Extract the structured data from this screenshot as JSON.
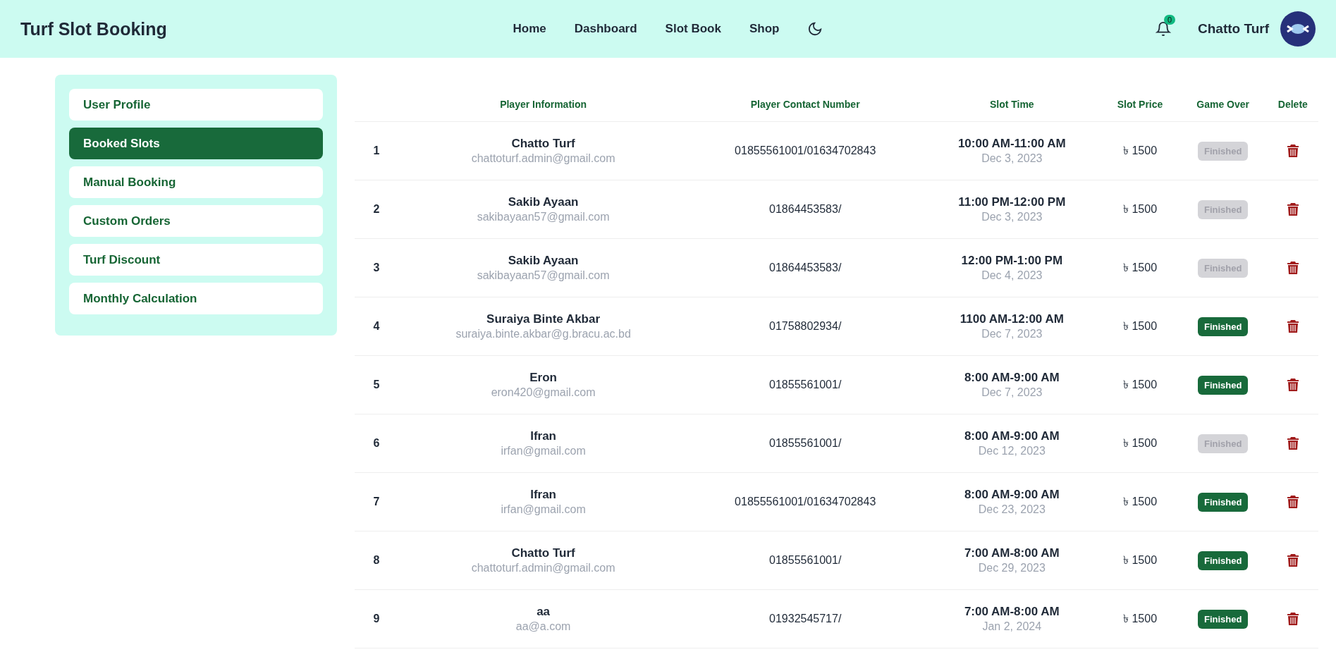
{
  "header": {
    "title": "Turf Slot Booking",
    "nav": [
      "Home",
      "Dashboard",
      "Slot Book",
      "Shop"
    ],
    "notification_count": "0",
    "user_name": "Chatto Turf"
  },
  "sidebar": {
    "items": [
      {
        "label": "User Profile",
        "selected": false
      },
      {
        "label": "Booked Slots",
        "selected": true
      },
      {
        "label": "Manual Booking",
        "selected": false
      },
      {
        "label": "Custom Orders",
        "selected": false
      },
      {
        "label": "Turf Discount",
        "selected": false
      },
      {
        "label": "Monthly Calculation",
        "selected": false
      }
    ]
  },
  "table": {
    "columns": [
      "Player Information",
      "Player Contact Number",
      "Slot Time",
      "Slot Price",
      "Game Over",
      "Delete"
    ],
    "rows": [
      {
        "index": "1",
        "name": "Chatto Turf",
        "email": "chattoturf.admin@gmail.com",
        "contact": "01855561001/01634702843",
        "time": "10:00 AM-11:00 AM",
        "date": "Dec 3, 2023",
        "price": "৳ 1500",
        "status": "Finished",
        "disabled": true
      },
      {
        "index": "2",
        "name": "Sakib Ayaan",
        "email": "sakibayaan57@gmail.com",
        "contact": "01864453583/",
        "time": "11:00 PM-12:00 PM",
        "date": "Dec 3, 2023",
        "price": "৳ 1500",
        "status": "Finished",
        "disabled": true
      },
      {
        "index": "3",
        "name": "Sakib Ayaan",
        "email": "sakibayaan57@gmail.com",
        "contact": "01864453583/",
        "time": "12:00 PM-1:00 PM",
        "date": "Dec 4, 2023",
        "price": "৳ 1500",
        "status": "Finished",
        "disabled": true
      },
      {
        "index": "4",
        "name": "Suraiya Binte Akbar",
        "email": "suraiya.binte.akbar@g.bracu.ac.bd",
        "contact": "01758802934/",
        "time": "1100 AM-12:00 AM",
        "date": "Dec 7, 2023",
        "price": "৳ 1500",
        "status": "Finished",
        "disabled": false
      },
      {
        "index": "5",
        "name": "Eron",
        "email": "eron420@gmail.com",
        "contact": "01855561001/",
        "time": "8:00 AM-9:00 AM",
        "date": "Dec 7, 2023",
        "price": "৳ 1500",
        "status": "Finished",
        "disabled": false
      },
      {
        "index": "6",
        "name": "Ifran",
        "email": "irfan@gmail.com",
        "contact": "01855561001/",
        "time": "8:00 AM-9:00 AM",
        "date": "Dec 12, 2023",
        "price": "৳ 1500",
        "status": "Finished",
        "disabled": true
      },
      {
        "index": "7",
        "name": "Ifran",
        "email": "irfan@gmail.com",
        "contact": "01855561001/01634702843",
        "time": "8:00 AM-9:00 AM",
        "date": "Dec 23, 2023",
        "price": "৳ 1500",
        "status": "Finished",
        "disabled": false
      },
      {
        "index": "8",
        "name": "Chatto Turf",
        "email": "chattoturf.admin@gmail.com",
        "contact": "01855561001/",
        "time": "7:00 AM-8:00 AM",
        "date": "Dec 29, 2023",
        "price": "৳ 1500",
        "status": "Finished",
        "disabled": false
      },
      {
        "index": "9",
        "name": "aa",
        "email": "aa@a.com",
        "contact": "01932545717/",
        "time": "7:00 AM-8:00 AM",
        "date": "Jan 2, 2024",
        "price": "৳ 1500",
        "status": "Finished",
        "disabled": false
      }
    ]
  }
}
